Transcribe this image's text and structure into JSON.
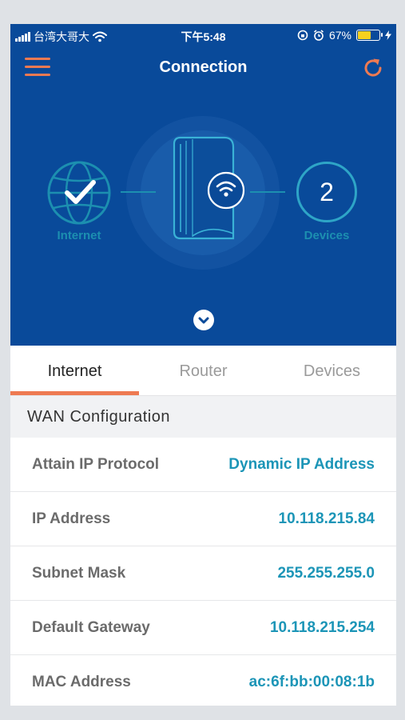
{
  "status_bar": {
    "carrier": "台湾大哥大",
    "time": "下午5:48",
    "battery": "67%",
    "battery_level": 0.67
  },
  "header": {
    "title": "Connection",
    "menu_icon": "hamburger-icon",
    "refresh_icon": "refresh-icon"
  },
  "diagram": {
    "internet_label": "Internet",
    "devices_label": "Devices",
    "devices_count": "2",
    "router_icon": "router-icon",
    "wifi_icon": "wifi-icon",
    "globe_icon": "globe-check-icon"
  },
  "tabs": [
    {
      "label": "Internet",
      "active": true
    },
    {
      "label": "Router",
      "active": false
    },
    {
      "label": "Devices",
      "active": false
    }
  ],
  "section": {
    "title": "WAN Configuration"
  },
  "rows": [
    {
      "label": "Attain IP Protocol",
      "value": "Dynamic IP Address"
    },
    {
      "label": "IP Address",
      "value": "10.118.215.84"
    },
    {
      "label": "Subnet Mask",
      "value": "255.255.255.0"
    },
    {
      "label": "Default Gateway",
      "value": "10.118.215.254"
    },
    {
      "label": "MAC Address",
      "value": "ac:6f:bb:00:08:1b"
    }
  ],
  "colors": {
    "hero_bg": "#094a9a",
    "accent": "#ee7a52",
    "teal": "#1c95b7",
    "battery": "#f7d11e"
  }
}
